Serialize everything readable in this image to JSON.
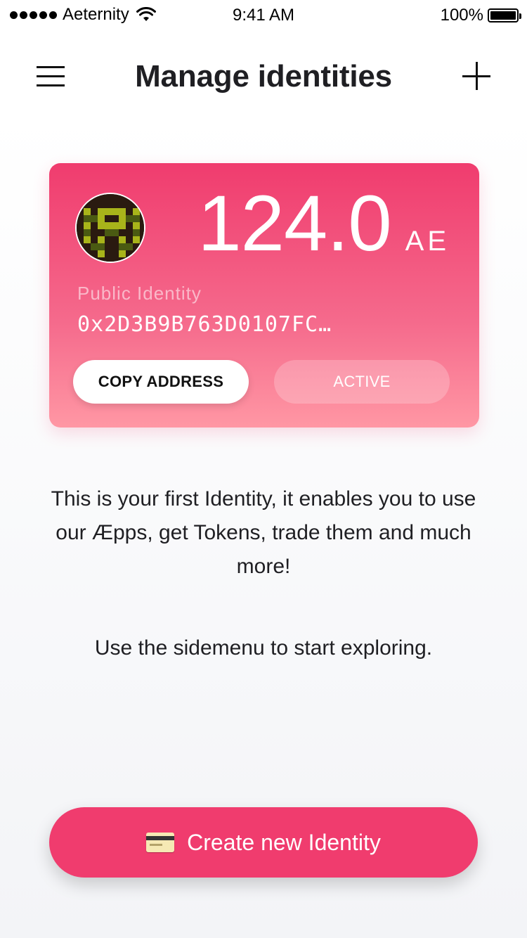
{
  "status_bar": {
    "carrier": "Aeternity",
    "time": "9:41 AM",
    "battery_percent": "100%"
  },
  "header": {
    "title": "Manage identities",
    "menu_icon": "hamburger-icon",
    "add_icon": "plus-icon"
  },
  "identity_card": {
    "balance": "124.0",
    "currency": "AE",
    "label": "Public Identity",
    "address": "0x2D3B9B763D0107FC…",
    "copy_button_label": "COPY ADDRESS",
    "active_button_label": "ACTIVE",
    "avatar_icon": "identicon-avatar",
    "gradient_top": "#f03c6e",
    "gradient_bottom": "#ff97a4"
  },
  "content": {
    "description": "This is your first Identity, it enables you to use our Æpps, get Tokens, trade them and much more!",
    "hint": "Use the sidemenu to start exploring."
  },
  "footer": {
    "create_button_label": "Create new Identity",
    "create_button_icon": "credit-card-icon",
    "accent_color": "#f03c6e"
  }
}
